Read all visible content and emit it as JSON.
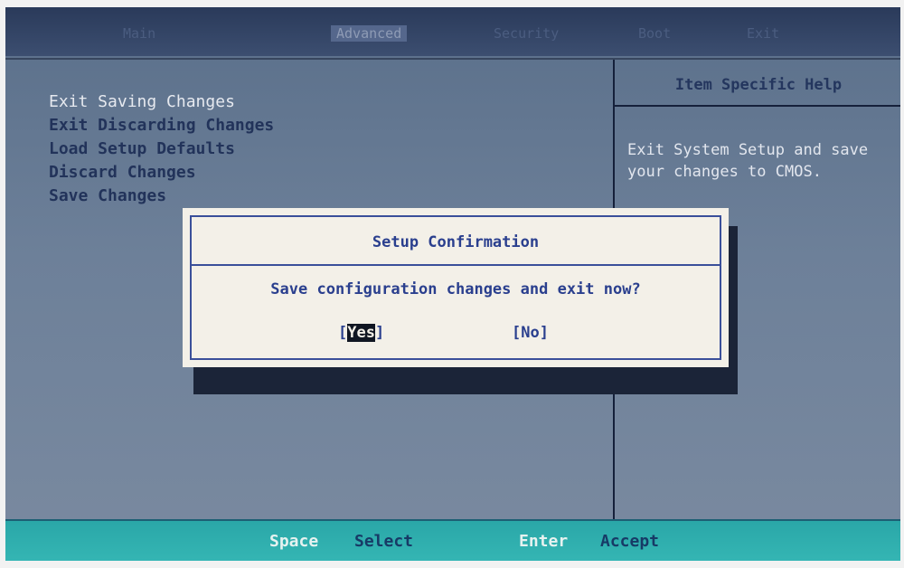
{
  "menubar": {
    "tabs": [
      "Main",
      "Advanced",
      "Security",
      "Boot",
      "Exit"
    ],
    "active_tab": "Advanced"
  },
  "exit_menu": {
    "items": [
      "Exit Saving Changes",
      "Exit Discarding Changes",
      "Load Setup Defaults",
      "Discard Changes",
      "Save Changes"
    ],
    "selected_index": 0
  },
  "help_panel": {
    "title": "Item Specific Help",
    "text": "Exit System Setup and save your changes to CMOS."
  },
  "dialog": {
    "title": "Setup Confirmation",
    "message": "Save configuration changes and exit now?",
    "yes_open": "[",
    "yes_label": "Yes",
    "yes_close": "]",
    "no_label": "[No]"
  },
  "statusbar": {
    "key1": "Space",
    "desc1": "Select",
    "key2": "Enter",
    "desc2": "Accept"
  },
  "colors": {
    "screen_bg": "#6d8099",
    "dialog_bg": "#f3f0e8",
    "dialog_text": "#2a3f8e",
    "statusbar_bg": "#35b6b4"
  }
}
